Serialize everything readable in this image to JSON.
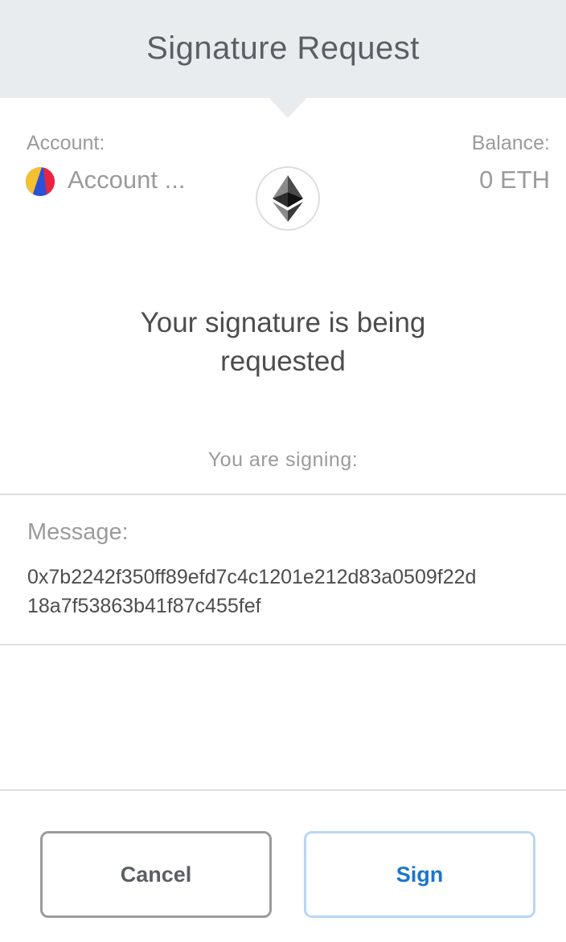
{
  "header": {
    "title": "Signature Request"
  },
  "account": {
    "label": "Account:",
    "name": "Account ...",
    "avatar_colors": [
      "#f5c02e",
      "#2d50d8",
      "#e8253f"
    ]
  },
  "balance": {
    "label": "Balance:",
    "value": "0 ETH"
  },
  "network_icon": "ethereum-icon",
  "request": {
    "headline_line1": "Your signature is being",
    "headline_line2": "requested",
    "signing_label": "You are signing:"
  },
  "message": {
    "label": "Message:",
    "value_line1": "0x7b2242f350ff89efd7c4c1201e212d83a0509f22d",
    "value_line2": "18a7f53863b41f87c455fef"
  },
  "actions": {
    "cancel_label": "Cancel",
    "sign_label": "Sign"
  },
  "colors": {
    "accent": "#1a75cf",
    "header_bg": "#e9ecef",
    "muted_text": "#9b9b9b"
  }
}
